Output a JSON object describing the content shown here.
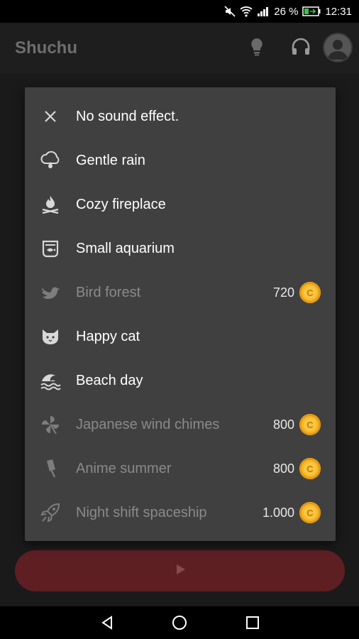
{
  "status_bar": {
    "battery_percent": "26 %",
    "time": "12:31"
  },
  "app_bar": {
    "title": "Shuchu"
  },
  "sound_menu": {
    "items": [
      {
        "label": "No sound effect.",
        "icon": "close-icon",
        "locked": false,
        "price": ""
      },
      {
        "label": "Gentle rain",
        "icon": "rain-cloud-icon",
        "locked": false,
        "price": ""
      },
      {
        "label": "Cozy fireplace",
        "icon": "campfire-icon",
        "locked": false,
        "price": ""
      },
      {
        "label": "Small aquarium",
        "icon": "fishbowl-icon",
        "locked": false,
        "price": ""
      },
      {
        "label": "Bird forest",
        "icon": "bird-icon",
        "locked": true,
        "price": "720"
      },
      {
        "label": "Happy cat",
        "icon": "cat-icon",
        "locked": false,
        "price": ""
      },
      {
        "label": "Beach day",
        "icon": "wave-icon",
        "locked": false,
        "price": ""
      },
      {
        "label": "Japanese wind chimes",
        "icon": "pinwheel-icon",
        "locked": true,
        "price": "800"
      },
      {
        "label": "Anime summer",
        "icon": "popsicle-icon",
        "locked": true,
        "price": "800"
      },
      {
        "label": "Night shift spaceship",
        "icon": "rocket-icon",
        "locked": true,
        "price": "1.000"
      }
    ]
  },
  "colors": {
    "accent_play": "#5e1f22",
    "coin": "#f5b82a",
    "menu_bg": "#404040"
  }
}
